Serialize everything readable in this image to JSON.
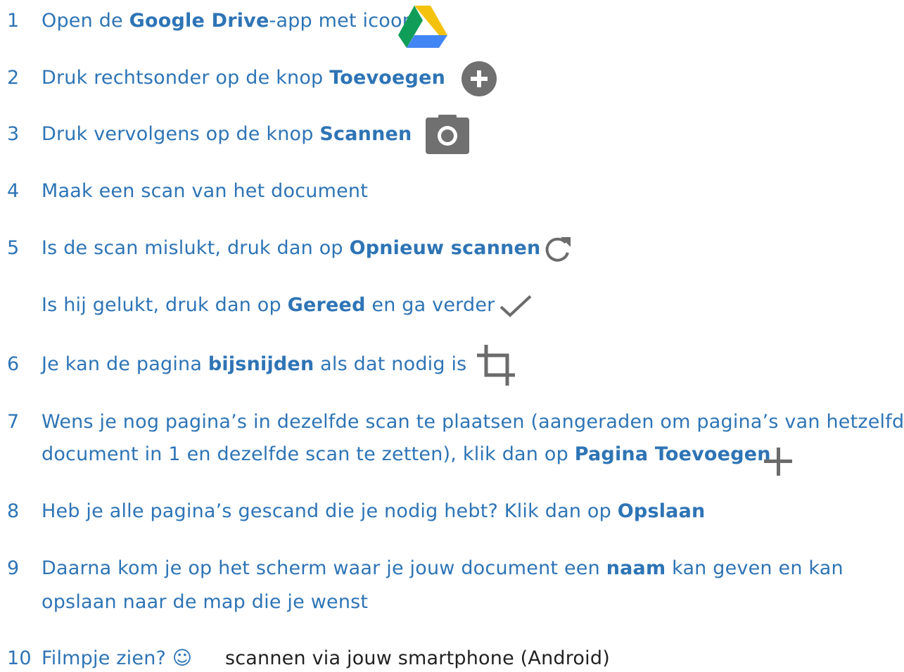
{
  "steps": [
    {
      "num": "1",
      "pre": "Open de ",
      "bold": "Google Drive",
      "post": "-app met icoon",
      "icon": "google-drive-icon"
    },
    {
      "num": "2",
      "pre": "Druk rechtsonder op de knop ",
      "bold": "Toevoegen",
      "icon": "add-circle-icon"
    },
    {
      "num": "3",
      "pre": "Druk vervolgens op de knop ",
      "bold": "Scannen",
      "icon": "camera-icon"
    },
    {
      "num": "4",
      "text": "Maak een scan van het document"
    },
    {
      "num": "5",
      "pre": "Is de scan mislukt, druk dan op ",
      "bold": "Opnieuw scannen",
      "icon": "refresh-icon"
    },
    {
      "pre": "Is hij gelukt, druk dan op ",
      "bold": "Gereed",
      "post": " en ga verder",
      "icon": "checkmark-icon"
    },
    {
      "num": "6",
      "pre": "Je kan de pagina ",
      "bold": "bijsnijden",
      "post": " als dat nodig is",
      "icon": "crop-icon"
    },
    {
      "num": "7",
      "line1": "Wens je nog pagina’s in dezelfde scan te plaatsen (aangeraden om pagina’s van hetzelfde",
      "pre": "document in 1 en dezelfde scan te zetten), klik dan op ",
      "bold": "Pagina Toevoegen",
      "icon": "plus-icon"
    },
    {
      "num": "8",
      "pre": "Heb je alle pagina’s gescand die je nodig hebt? Klik dan op ",
      "bold": "Opslaan"
    },
    {
      "num": "9",
      "pre": "Daarna kom je op het scherm waar je jouw document een ",
      "bold": "naam",
      "post": " kan geven en kan",
      "line2": "opslaan naar de map die je wenst"
    },
    {
      "num": "10",
      "text": "Filmpje zien? ☺",
      "link": "scannen via jouw smartphone (Android)"
    }
  ],
  "colors": {
    "text": "#2e74b5",
    "icon_gray": "#6b6b6b",
    "link": "#222222"
  }
}
